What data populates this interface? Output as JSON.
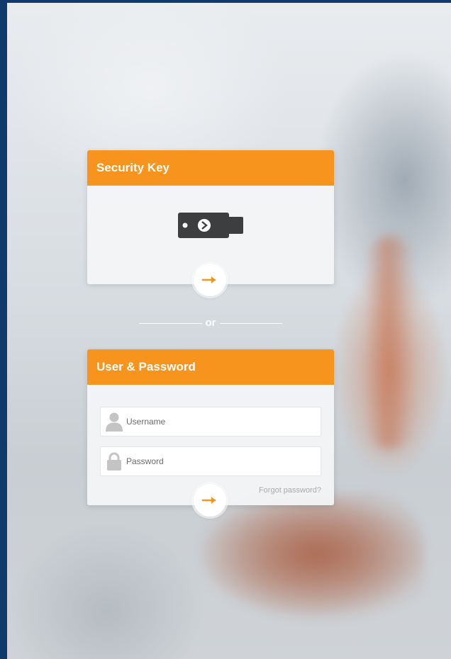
{
  "security_key": {
    "title": "Security Key",
    "icon": "usb-security-key-icon",
    "submit_icon": "arrow-right-icon"
  },
  "divider": {
    "text": "or"
  },
  "login": {
    "title": "User & Password",
    "username": {
      "placeholder": "Username",
      "value": "",
      "icon": "user-icon"
    },
    "password": {
      "placeholder": "Password",
      "value": "",
      "icon": "lock-icon"
    },
    "forgot_link": "Forgot password?",
    "submit_icon": "arrow-right-icon"
  },
  "colors": {
    "accent": "#f7941d",
    "frame": "#0f3a6b",
    "card": "#f4f5f7"
  }
}
